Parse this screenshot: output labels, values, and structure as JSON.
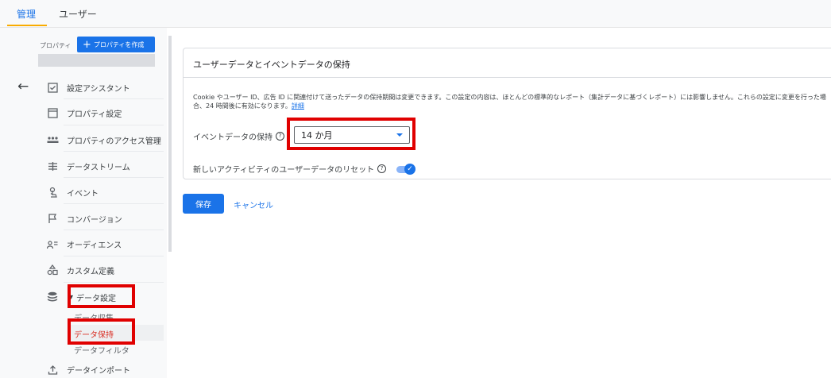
{
  "topbar": {
    "tabs": [
      "管理",
      "ユーザー"
    ],
    "active_tab": "管理"
  },
  "property": {
    "label": "プロパティ",
    "create_button": "プロパティを作成"
  },
  "sidebar": {
    "items": [
      {
        "label": "設定アシスタント",
        "icon": "checkbox-icon"
      },
      {
        "label": "プロパティ設定",
        "icon": "window-icon"
      },
      {
        "label": "プロパティのアクセス管理",
        "icon": "people-icon"
      },
      {
        "label": "データストリーム",
        "icon": "streams-icon"
      },
      {
        "label": "イベント",
        "icon": "touch-icon"
      },
      {
        "label": "コンバージョン",
        "icon": "flag-icon"
      },
      {
        "label": "オーディエンス",
        "icon": "audience-icon"
      },
      {
        "label": "カスタム定義",
        "icon": "shapes-icon"
      },
      {
        "label": "データ設定",
        "icon": "database-icon"
      },
      {
        "label": "データインポート",
        "icon": "upload-icon"
      }
    ],
    "sub_items": [
      "データ収集",
      "データ保持",
      "データフィルタ"
    ]
  },
  "card": {
    "title": "ユーザーデータとイベントデータの保持",
    "description": "Cookie やユーザー ID、広告 ID に関連付けて送ったデータの保持期間は変更できます。この設定の内容は、ほとんどの標準的なレポート（集計データに基づくレポート）には影響しません。これらの設定に変更を行った場合、24 時間後に有効になります。",
    "detail_link": "詳細",
    "event_retention_label": "イベントデータの保持",
    "event_retention_value": "14 か月",
    "reset_label": "新しいアクティビティのユーザーデータのリセット",
    "reset_enabled": true
  },
  "actions": {
    "save": "保存",
    "cancel": "キャンセル"
  },
  "colors": {
    "accent": "#1a73e8",
    "highlight": "#e00000",
    "tab_underline": "#f9ab00"
  }
}
